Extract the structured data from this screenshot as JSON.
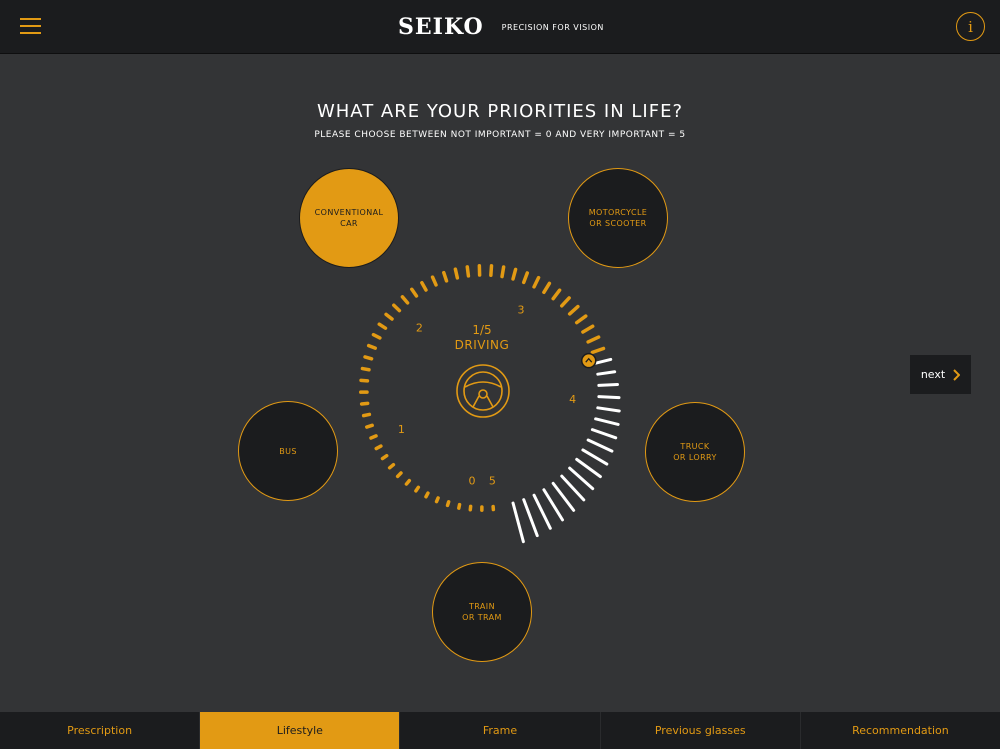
{
  "header": {
    "brand": "SEIKO",
    "tagline": "PRECISION FOR VISION",
    "info_label": "i"
  },
  "question": {
    "title": "WHAT ARE YOUR PRIORITIES IN LIFE?",
    "subtitle": "PLEASE CHOOSE BETWEEN NOT IMPORTANT = 0 AND VERY IMPORTANT = 5"
  },
  "options": {
    "car": "CONVENTIONAL\nCAR",
    "moto": "MOTORCYCLE\nOR SCOOTER",
    "bus": "BUS",
    "truck": "TRUCK\nOR LORRY",
    "train": "TRAIN\nOR TRAM"
  },
  "dial": {
    "step": "1/5",
    "label": "DRIVING",
    "scale": [
      "0",
      "1",
      "2",
      "3",
      "4",
      "5"
    ],
    "value": 3.7,
    "max": 5,
    "icon": "steering-wheel-icon"
  },
  "next_label": "next",
  "nav": {
    "prescription": "Prescription",
    "lifestyle": "Lifestyle",
    "frame": "Frame",
    "previous": "Previous glasses",
    "recommendation": "Recommendation"
  },
  "colors": {
    "accent": "#e29a14",
    "background": "#333436",
    "panel": "#1b1c1e",
    "inactive_tick": "#ffffff"
  }
}
